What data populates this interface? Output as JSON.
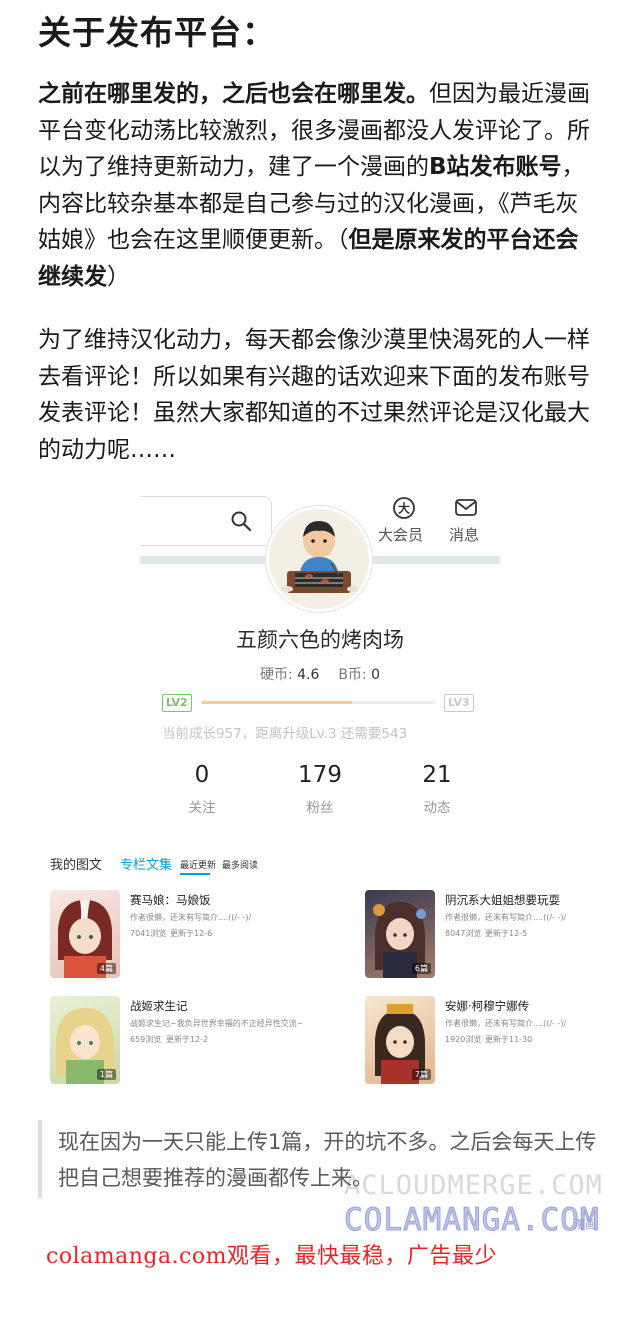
{
  "heading": "关于发布平台：",
  "para1": {
    "b1": "之前在哪里发的，之后也会在哪里发。",
    "t1": "但因为最近漫画平台变化动荡比较激烈，很多漫画都没人发评论了。所以为了维持更新动力，建了一个漫画的",
    "b2": "B站发布账号",
    "t2": "，内容比较杂基本都是自己参与过的汉化漫画，《芦毛灰姑娘》也会在这里顺便更新。（",
    "b3": "但是原来发的平台还会继续发",
    "t3": "）"
  },
  "para2": "为了维持汉化动力，每天都会像沙漠里快渴死的人一样去看评论！所以如果有兴趣的话欢迎来下面的发布账号发表评论！虽然大家都知道的不过果然评论是汉化最大的动力呢……",
  "profile": {
    "vip_label": "大会员",
    "message_label": "消息",
    "username": "五颜六色的烤肉场",
    "coins_label": "硬币:",
    "coins_value": "4.6",
    "bcoins_label": "B币:",
    "bcoins_value": "0",
    "level_current": "LV2",
    "level_next": "LV3",
    "level_progress": 0.64,
    "growth_text": "当前成长957，距离升级Lv.3 还需要543",
    "stats": [
      {
        "value": "0",
        "label": "关注"
      },
      {
        "value": "179",
        "label": "粉丝"
      },
      {
        "value": "21",
        "label": "动态"
      }
    ],
    "tabs": {
      "my_posts": "我的图文",
      "columns": "专栏文集",
      "recent": "最近更新",
      "most_read": "最多阅读"
    },
    "cards": [
      {
        "title": "赛马娘：马娘饭",
        "desc": "作者很懒，还未有写简介....((/- -)/",
        "views": "7041浏览",
        "updated": "更新于12-6",
        "count": "4篇"
      },
      {
        "title": "阴沉系大姐姐想要玩耍",
        "desc": "作者很懒，还未有写简介....((/- -)/",
        "views": "8047浏览",
        "updated": "更新于12-5",
        "count": "6篇"
      },
      {
        "title": "战姬求生记",
        "desc": "战姬求生记~我负异世界幸福的不正经异性交流~",
        "views": "659浏览",
        "updated": "更新于12-2",
        "count": "1篇"
      },
      {
        "title": "安娜·柯穆宁娜传",
        "desc": "作者很懒，还未有写简介....((/- -)/",
        "views": "1920浏览",
        "updated": "更新于11-30",
        "count": "7篇"
      }
    ]
  },
  "quote": "现在因为一天只能上传1篇，开的坑不多。之后会每天上传把自己想要推荐的漫画都传上来。",
  "watermark1": "ACLOUDMERGE.COM",
  "watermark2": "COLAMANGA.COM",
  "watermark_small": "漫画",
  "ad_text": "colamanga.com观看，最快最稳，广告最少",
  "colors": {
    "accent": "#00a1d6",
    "level_green": "#7ec26e",
    "progress": "#f1d27f",
    "ad_red": "#e8242a"
  }
}
